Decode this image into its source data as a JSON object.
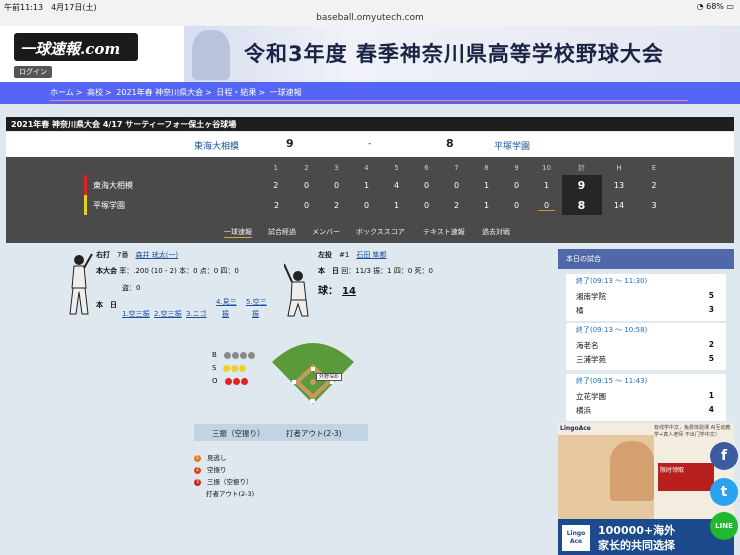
{
  "status": {
    "time": "午前11:13",
    "date": "4月17日(土)",
    "url": "baseball.omyutech.com",
    "battery": "68%"
  },
  "site": {
    "logo": "一球速報.com",
    "login": "ログイン",
    "banner_title": "令和3年度 春季神奈川県高等学校野球大会"
  },
  "breadcrumb": [
    "ホーム",
    "高校",
    "2021年春 神奈川県大会",
    "日程・結果",
    "一球速報"
  ],
  "breadcrumb_sep": ">",
  "game": {
    "header": "2021年春 神奈川県大会 4/17 サーティーフォー保土ヶ谷球場",
    "home": "東海大相模",
    "home_score": "9",
    "dash": "-",
    "away_score": "8",
    "away": "平塚学園"
  },
  "scoreboard": {
    "headers": [
      "1",
      "2",
      "3",
      "4",
      "5",
      "6",
      "7",
      "8",
      "9",
      "10",
      "計",
      "H",
      "E"
    ],
    "rows": [
      {
        "team": "東海大相模",
        "innings": [
          "2",
          "0",
          "0",
          "1",
          "4",
          "0",
          "0",
          "1",
          "0",
          "1"
        ],
        "total": "9",
        "h": "13",
        "e": "2"
      },
      {
        "team": "平塚学園",
        "innings": [
          "2",
          "0",
          "2",
          "0",
          "1",
          "0",
          "2",
          "1",
          "0",
          "0"
        ],
        "total": "8",
        "h": "14",
        "e": "3"
      }
    ]
  },
  "tabs": [
    "一球速報",
    "試合経過",
    "メンバー",
    "ボックススコア",
    "テキスト速報",
    "過去対戦"
  ],
  "batter": {
    "hand": "右打",
    "order": "7番",
    "name": "森井 珖太(一)",
    "stat_label": "本大会",
    "stats": "率：.200 (10 - 2)  本：0  点：0  四：0",
    "steal": "盗：0",
    "today_label": "本　日",
    "today_top": [
      "4.見三",
      "5.空三"
    ],
    "today_top2": [
      "振",
      "振"
    ],
    "today": [
      "1.空三振",
      "2.空三振",
      "3.ニゴ"
    ]
  },
  "pitcher": {
    "hand": "左投",
    "number": "#1",
    "name": "石田 隼都",
    "today_label": "本　日",
    "stats": "回：11/3  振：1  四：0  死：0",
    "pitch_label": "球：",
    "pitches": "14"
  },
  "count": {
    "b_label": "B",
    "s_label": "S",
    "o_label": "O",
    "balls": 0,
    "strikes": 3,
    "outs": 3
  },
  "field_label": "外野深め",
  "result": {
    "play": "三振（空振り）",
    "outcome": "打者アウト(2-3)"
  },
  "pitch_log": [
    {
      "n": "1",
      "label": "見逃し",
      "color": "#e07a20"
    },
    {
      "n": "2",
      "label": "空振り",
      "color": "#e0401a"
    },
    {
      "n": "3",
      "label": "三振（空振り）",
      "color": "#d02020"
    }
  ],
  "pitch_log_footer": "打者アウト(2-3)",
  "today_games": {
    "title": "本日の試合",
    "games": [
      {
        "time": "終了(09:13 ～ 11:30)",
        "t1": "湘南学院",
        "s1": "5",
        "t2": "橘",
        "s2": "3"
      },
      {
        "time": "終了(09:13 ～ 10:58)",
        "t1": "海老名",
        "s1": "2",
        "t2": "三浦学苑",
        "s2": "5"
      },
      {
        "time": "終了(09:15 ～ 11:43)",
        "t1": "立花学園",
        "s1": "1",
        "t2": "横浜",
        "s2": "4"
      }
    ]
  },
  "ad": {
    "brand": "LingoAce",
    "top_text": "有线学中文，兔费体验课 AI互动教学+真人老师 不出门学中文！",
    "red_text": "限时领取",
    "headline1": "100000+海外",
    "headline2": "家长的共同选择",
    "logo_text": "Lingo Ace"
  },
  "share": {
    "facebook": "f",
    "twitter": "t",
    "line": "LINE"
  }
}
